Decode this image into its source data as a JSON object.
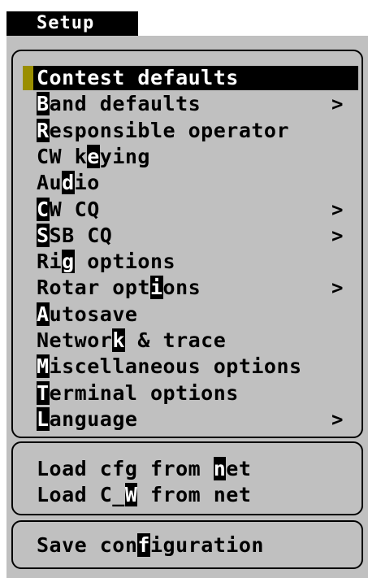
{
  "window": {
    "title": "Setup"
  },
  "menu": {
    "arrow_glyph": ">",
    "main_items": [
      {
        "pre": "",
        "hotkey": "",
        "post": "Contest defaults",
        "submenu": false,
        "selected": true
      },
      {
        "pre": "",
        "hotkey": "B",
        "post": "and defaults",
        "submenu": true,
        "selected": false
      },
      {
        "pre": "",
        "hotkey": "R",
        "post": "esponsible operator",
        "submenu": false,
        "selected": false
      },
      {
        "pre": "CW k",
        "hotkey": "e",
        "post": "ying",
        "submenu": false,
        "selected": false
      },
      {
        "pre": "Au",
        "hotkey": "d",
        "post": "io",
        "submenu": false,
        "selected": false
      },
      {
        "pre": "",
        "hotkey": "C",
        "post": "W CQ",
        "submenu": true,
        "selected": false
      },
      {
        "pre": "",
        "hotkey": "S",
        "post": "SB CQ",
        "submenu": true,
        "selected": false
      },
      {
        "pre": "Ri",
        "hotkey": "g",
        "post": " options",
        "submenu": false,
        "selected": false
      },
      {
        "pre": "Rotar opt",
        "hotkey": "i",
        "post": "ons",
        "submenu": true,
        "selected": false
      },
      {
        "pre": "",
        "hotkey": "A",
        "post": "utosave",
        "submenu": false,
        "selected": false
      },
      {
        "pre": "Networ",
        "hotkey": "k",
        "post": " & trace",
        "submenu": false,
        "selected": false
      },
      {
        "pre": "",
        "hotkey": "M",
        "post": "iscellaneous options",
        "submenu": false,
        "selected": false
      },
      {
        "pre": "",
        "hotkey": "T",
        "post": "erminal options",
        "submenu": false,
        "selected": false
      },
      {
        "pre": "",
        "hotkey": "L",
        "post": "anguage",
        "submenu": true,
        "selected": false
      }
    ],
    "net_items": [
      {
        "pre": "Load cfg from ",
        "hotkey": "n",
        "post": "et",
        "submenu": false,
        "selected": false
      },
      {
        "pre": "Load C_",
        "hotkey": "W",
        "post": " from net",
        "submenu": false,
        "selected": false
      }
    ],
    "save_items": [
      {
        "pre": "Save con",
        "hotkey": "f",
        "post": "iguration",
        "submenu": false,
        "selected": false
      }
    ]
  },
  "colors": {
    "panel_bg": "#c0c0c0",
    "selection_bg": "#000000",
    "selection_marker": "#9a8e00",
    "hotkey_bg": "#000000",
    "hotkey_fg": "#ffffff"
  }
}
